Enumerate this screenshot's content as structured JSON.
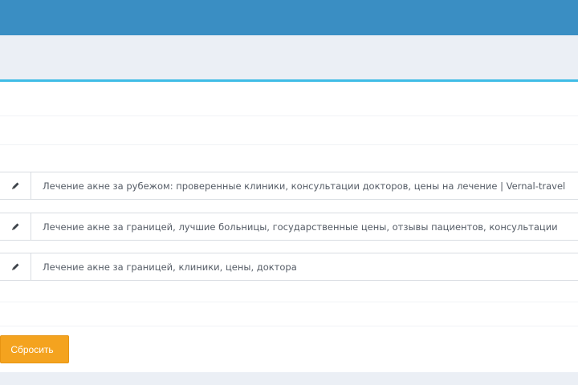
{
  "fields": [
    {
      "icon": "pencil-icon",
      "value": "Лечение акне за рубежом:  проверенные клиники,  консультации докторов, цены на лечение | Vernal-travel"
    },
    {
      "icon": "pencil-icon",
      "value": "Лечение акне за границей, лучшие больницы, государственные цены, отзывы пациентов, консультации"
    },
    {
      "icon": "pencil-icon",
      "value": "Лечение акне за границей, клиники, цены, доктора"
    }
  ],
  "buttons": {
    "reset_label": "Сбросить"
  },
  "colors": {
    "header": "#3a8ec3",
    "accent": "#3fbce6",
    "button": "#f4a31f"
  }
}
